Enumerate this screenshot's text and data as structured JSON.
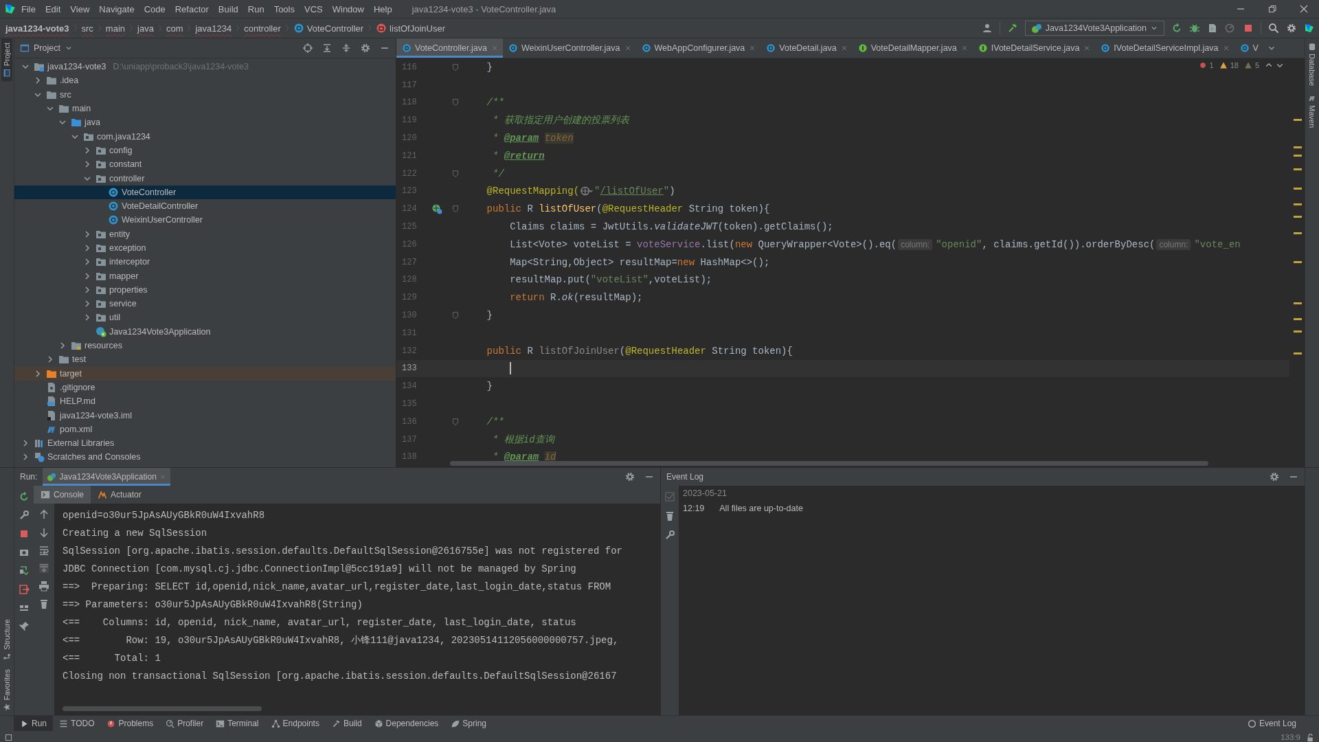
{
  "menu_bar": {
    "items": [
      "File",
      "Edit",
      "View",
      "Navigate",
      "Code",
      "Refactor",
      "Build",
      "Run",
      "Tools",
      "VCS",
      "Window",
      "Help"
    ],
    "title": "java1234-vote3 - VoteController.java"
  },
  "breadcrumbs": [
    {
      "label": "java1234-vote3",
      "kind": "module"
    },
    {
      "label": "src",
      "kind": "folder"
    },
    {
      "label": "main",
      "kind": "folder"
    },
    {
      "label": "java",
      "kind": "folder"
    },
    {
      "label": "com",
      "kind": "folder"
    },
    {
      "label": "java1234",
      "kind": "folder"
    },
    {
      "label": "controller",
      "kind": "folder"
    },
    {
      "label": "VoteController",
      "kind": "class"
    },
    {
      "label": "listOfJoinUser",
      "kind": "method"
    }
  ],
  "run_configuration": "Java1234Vote3Application",
  "left_stripe": [
    {
      "label": "Project",
      "selected": true
    },
    {
      "label": "Structure",
      "selected": false
    },
    {
      "label": "Favorites",
      "selected": false
    }
  ],
  "right_stripe": [
    {
      "label": "Database"
    },
    {
      "label": "Maven"
    }
  ],
  "project_panel": {
    "title": "Project",
    "tree": [
      {
        "label": "java1234-vote3",
        "path": "D:\\uniapp\\proback3\\java1234-vote3",
        "kind": "module",
        "expanded": true,
        "selected": false,
        "children": [
          {
            "label": ".idea",
            "kind": "folder",
            "expanded": false,
            "selected": false
          },
          {
            "label": "src",
            "kind": "folder",
            "expanded": true,
            "selected": false,
            "children": [
              {
                "label": "main",
                "kind": "folder",
                "expanded": true,
                "selected": false,
                "children": [
                  {
                    "label": "java",
                    "kind": "source-folder",
                    "expanded": true,
                    "selected": false,
                    "children": [
                      {
                        "label": "com.java1234",
                        "kind": "package",
                        "expanded": true,
                        "selected": false,
                        "children": [
                          {
                            "label": "config",
                            "kind": "package",
                            "expanded": false,
                            "selected": false
                          },
                          {
                            "label": "constant",
                            "kind": "package",
                            "expanded": false,
                            "selected": false
                          },
                          {
                            "label": "controller",
                            "kind": "package",
                            "expanded": true,
                            "selected": false,
                            "children": [
                              {
                                "label": "VoteController",
                                "kind": "class",
                                "selected": true
                              },
                              {
                                "label": "VoteDetailController",
                                "kind": "class",
                                "selected": false
                              },
                              {
                                "label": "WeixinUserController",
                                "kind": "class",
                                "selected": false
                              }
                            ]
                          },
                          {
                            "label": "entity",
                            "kind": "package",
                            "expanded": false,
                            "selected": false
                          },
                          {
                            "label": "exception",
                            "kind": "package",
                            "expanded": false,
                            "selected": false
                          },
                          {
                            "label": "interceptor",
                            "kind": "package",
                            "expanded": false,
                            "selected": false
                          },
                          {
                            "label": "mapper",
                            "kind": "package",
                            "expanded": false,
                            "selected": false
                          },
                          {
                            "label": "properties",
                            "kind": "package",
                            "expanded": false,
                            "selected": false
                          },
                          {
                            "label": "service",
                            "kind": "package",
                            "expanded": false,
                            "selected": false
                          },
                          {
                            "label": "util",
                            "kind": "package",
                            "expanded": false,
                            "selected": false
                          },
                          {
                            "label": "Java1234Vote3Application",
                            "kind": "app",
                            "selected": false
                          }
                        ]
                      }
                    ]
                  },
                  {
                    "label": "resources",
                    "kind": "resources",
                    "expanded": false,
                    "selected": false
                  }
                ]
              },
              {
                "label": "test",
                "kind": "folder",
                "expanded": false,
                "selected": false
              }
            ]
          },
          {
            "label": "target",
            "kind": "excluded",
            "expanded": false,
            "selected": false
          },
          {
            "label": ".gitignore",
            "kind": "git",
            "selected": false
          },
          {
            "label": "HELP.md",
            "kind": "md",
            "selected": false
          },
          {
            "label": "java1234-vote3.iml",
            "kind": "iml",
            "selected": false
          },
          {
            "label": "pom.xml",
            "kind": "maven",
            "selected": false
          }
        ]
      },
      {
        "label": "External Libraries",
        "kind": "libraries",
        "expanded": false,
        "selected": false
      },
      {
        "label": "Scratches and Consoles",
        "kind": "scratches",
        "expanded": false,
        "selected": false
      }
    ]
  },
  "editor_tabs": [
    {
      "label": "VoteController.java",
      "kind": "class",
      "selected": true,
      "closable": true
    },
    {
      "label": "WeixinUserController.java",
      "kind": "class",
      "selected": false,
      "closable": true
    },
    {
      "label": "WebAppConfigurer.java",
      "kind": "class",
      "selected": false,
      "closable": true
    },
    {
      "label": "VoteDetail.java",
      "kind": "class",
      "selected": false,
      "closable": true
    },
    {
      "label": "VoteDetailMapper.java",
      "kind": "interface",
      "selected": false,
      "closable": true
    },
    {
      "label": "IVoteDetailService.java",
      "kind": "interface",
      "selected": false,
      "closable": true
    },
    {
      "label": "IVoteDetailServiceImpl.java",
      "kind": "class",
      "selected": false,
      "closable": true
    },
    {
      "label": "V",
      "kind": "class",
      "selected": false,
      "closable": false
    }
  ],
  "inspections": {
    "errors": "1",
    "warnings": "18",
    "weak_warnings": "5"
  },
  "code_lines": [
    {
      "number": "116",
      "fold": true,
      "endpoint": false,
      "current": false,
      "tokens": [
        {
          "kind": "plain",
          "text": "    }"
        }
      ]
    },
    {
      "number": "117",
      "fold": false,
      "endpoint": false,
      "current": false
    },
    {
      "number": "118",
      "fold": true,
      "endpoint": false,
      "current": false,
      "tokens": [
        {
          "kind": "comment",
          "text": "    /**"
        }
      ]
    },
    {
      "number": "119",
      "fold": false,
      "endpoint": false,
      "current": false,
      "tokens": [
        {
          "kind": "comment",
          "text": "     * 获取指定用户创建的投票列表"
        }
      ]
    },
    {
      "number": "120",
      "fold": false,
      "endpoint": false,
      "current": false,
      "tokens": [
        {
          "kind": "comment",
          "text": "     * "
        },
        {
          "kind": "doc-tag",
          "text": "@param"
        },
        {
          "kind": "param-ref",
          "text": "token"
        }
      ]
    },
    {
      "number": "121",
      "fold": false,
      "endpoint": false,
      "current": false,
      "tokens": [
        {
          "kind": "comment",
          "text": "     * "
        },
        {
          "kind": "doc-tag",
          "text": "@return"
        }
      ]
    },
    {
      "number": "122",
      "fold": true,
      "endpoint": false,
      "current": false,
      "tokens": [
        {
          "kind": "comment",
          "text": "     */"
        }
      ]
    },
    {
      "number": "123",
      "fold": false,
      "endpoint": false,
      "current": false,
      "tokens": [
        {
          "kind": "annotation",
          "text": "    @RequestMapping("
        },
        {
          "kind": "web-icon"
        },
        {
          "kind": "string",
          "text": "\""
        },
        {
          "kind": "url",
          "text": "/listOfUser"
        },
        {
          "kind": "string",
          "text": "\""
        },
        {
          "kind": "plain",
          "text": ")"
        }
      ]
    },
    {
      "number": "124",
      "fold": true,
      "endpoint": true,
      "current": false,
      "tokens": [
        {
          "kind": "keyword",
          "text": "    public "
        },
        {
          "kind": "plain",
          "text": "R "
        },
        {
          "kind": "method-decl",
          "text": "listOfUser"
        },
        {
          "kind": "plain",
          "text": "("
        },
        {
          "kind": "annotation",
          "text": "@RequestHeader"
        },
        {
          "kind": "plain",
          "text": " String token){"
        }
      ]
    },
    {
      "number": "125",
      "fold": false,
      "endpoint": false,
      "current": false,
      "tokens": [
        {
          "kind": "plain",
          "text": "        Claims claims = JwtUtils."
        },
        {
          "kind": "static-call",
          "text": "validateJWT"
        },
        {
          "kind": "plain",
          "text": "(token).getClaims();"
        }
      ]
    },
    {
      "number": "126",
      "fold": false,
      "endpoint": false,
      "current": false,
      "tokens": [
        {
          "kind": "plain",
          "text": "        List<Vote> voteList = "
        },
        {
          "kind": "field",
          "text": "voteService"
        },
        {
          "kind": "plain",
          "text": ".list("
        },
        {
          "kind": "keyword",
          "text": "new "
        },
        {
          "kind": "plain",
          "text": "QueryWrapper<Vote>().eq("
        },
        {
          "kind": "hint",
          "text": "column:"
        },
        {
          "kind": "string",
          "text": "\"openid\""
        },
        {
          "kind": "plain",
          "text": ", claims.getId()).orderByDesc("
        },
        {
          "kind": "hint",
          "text": "column:"
        },
        {
          "kind": "string",
          "text": "\"vote_en"
        }
      ]
    },
    {
      "number": "127",
      "fold": false,
      "endpoint": false,
      "current": false,
      "tokens": [
        {
          "kind": "plain",
          "text": "        Map<String,Object> resultMap="
        },
        {
          "kind": "keyword",
          "text": "new "
        },
        {
          "kind": "plain",
          "text": "HashMap<>();"
        }
      ]
    },
    {
      "number": "128",
      "fold": false,
      "endpoint": false,
      "current": false,
      "tokens": [
        {
          "kind": "plain",
          "text": "        resultMap.put("
        },
        {
          "kind": "string",
          "text": "\"voteList\""
        },
        {
          "kind": "plain",
          "text": ",voteList);"
        }
      ]
    },
    {
      "number": "129",
      "fold": false,
      "endpoint": false,
      "current": false,
      "tokens": [
        {
          "kind": "keyword",
          "text": "        return "
        },
        {
          "kind": "plain",
          "text": "R."
        },
        {
          "kind": "static-call",
          "text": "ok"
        },
        {
          "kind": "plain",
          "text": "(resultMap);"
        }
      ]
    },
    {
      "number": "130",
      "fold": true,
      "endpoint": false,
      "current": false,
      "tokens": [
        {
          "kind": "plain",
          "text": "    }"
        }
      ]
    },
    {
      "number": "131",
      "fold": false,
      "endpoint": false,
      "current": false
    },
    {
      "number": "132",
      "fold": false,
      "endpoint": false,
      "current": false,
      "tokens": [
        {
          "kind": "keyword",
          "text": "    public "
        },
        {
          "kind": "plain",
          "text": "R "
        },
        {
          "kind": "unused",
          "text": "listOfJoinUser"
        },
        {
          "kind": "plain",
          "text": "("
        },
        {
          "kind": "annotation",
          "text": "@RequestHeader"
        },
        {
          "kind": "plain",
          "text": " String token){"
        }
      ]
    },
    {
      "number": "133",
      "fold": false,
      "endpoint": false,
      "current": true
    },
    {
      "number": "134",
      "fold": false,
      "endpoint": false,
      "current": false,
      "tokens": [
        {
          "kind": "plain",
          "text": "    }"
        }
      ]
    },
    {
      "number": "135",
      "fold": false,
      "endpoint": false,
      "current": false
    },
    {
      "number": "136",
      "fold": true,
      "endpoint": false,
      "current": false,
      "tokens": [
        {
          "kind": "comment",
          "text": "    /**"
        }
      ]
    },
    {
      "number": "137",
      "fold": false,
      "endpoint": false,
      "current": false,
      "tokens": [
        {
          "kind": "comment",
          "text": "     * 根据id查询"
        }
      ]
    },
    {
      "number": "138",
      "fold": false,
      "endpoint": false,
      "current": false,
      "tokens": [
        {
          "kind": "comment",
          "text": "     * "
        },
        {
          "kind": "doc-tag",
          "text": "@param"
        },
        {
          "kind": "param-ref",
          "text": "id"
        }
      ]
    }
  ],
  "run_panel": {
    "label": "Run:",
    "config_tab": "Java1234Vote3Application",
    "tabs": [
      {
        "label": "Console",
        "selected": true
      },
      {
        "label": "Actuator",
        "selected": false
      }
    ],
    "lines": [
      "openid=o30ur5JpAsAUyGBkR0uW4IxvahR8",
      "Creating a new SqlSession",
      "SqlSession [org.apache.ibatis.session.defaults.DefaultSqlSession@2616755e] was not registered for",
      "JDBC Connection [com.mysql.cj.jdbc.ConnectionImpl@5cc191a9] will not be managed by Spring",
      "==>  Preparing: SELECT id,openid,nick_name,avatar_url,register_date,last_login_date,status FROM",
      "==> Parameters: o30ur5JpAsAUyGBkR0uW4IxvahR8(String)",
      "<==    Columns: id, openid, nick_name, avatar_url, register_date, last_login_date, status",
      "<==        Row: 19, o30ur5JpAsAUyGBkR0uW4IxvahR8, 小锋111@java1234, 20230514112056000000757.jpeg,",
      "<==      Total: 1",
      "Closing non transactional SqlSession [org.apache.ibatis.session.defaults.DefaultSqlSession@26167"
    ]
  },
  "event_log": {
    "title": "Event Log",
    "date": "2023-05-21",
    "entries": [
      {
        "time": "12:19",
        "message": "All files are up-to-date"
      }
    ]
  },
  "tool_windows": [
    {
      "label": "Run",
      "kind": "run",
      "selected": true
    },
    {
      "label": "TODO",
      "kind": "todo",
      "selected": false
    },
    {
      "label": "Problems",
      "kind": "problems",
      "selected": false
    },
    {
      "label": "Profiler",
      "kind": "profiler",
      "selected": false
    },
    {
      "label": "Terminal",
      "kind": "terminal",
      "selected": false
    },
    {
      "label": "Endpoints",
      "kind": "endpoints",
      "selected": false
    },
    {
      "label": "Build",
      "kind": "build",
      "selected": false
    },
    {
      "label": "Dependencies",
      "kind": "dependencies",
      "selected": false
    },
    {
      "label": "Spring",
      "kind": "spring",
      "selected": false
    }
  ],
  "event_log_button": "Event Log",
  "status_bar": {
    "position": "133:9"
  }
}
